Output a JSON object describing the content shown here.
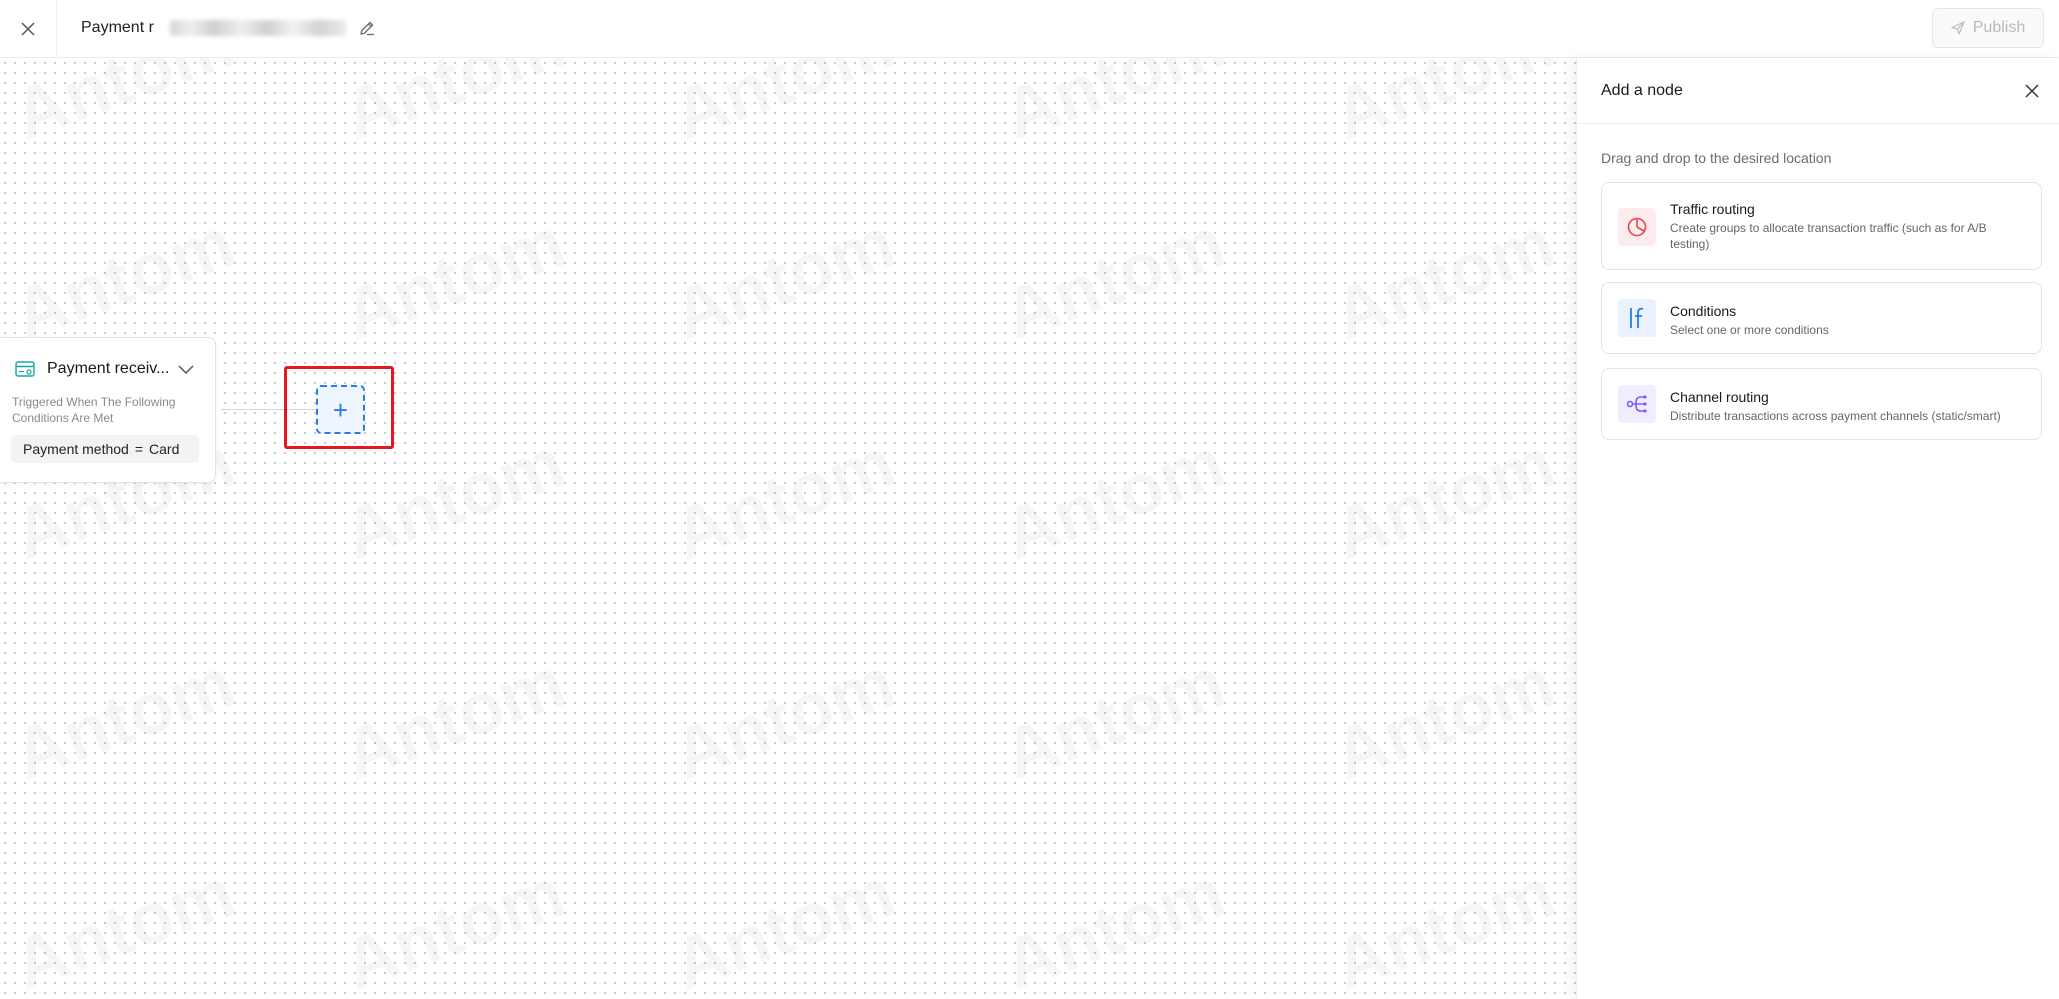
{
  "header": {
    "title_prefix": "Payment r",
    "publish_label": "Publish"
  },
  "canvas": {
    "watermark_text": "Antom",
    "trigger_node": {
      "title": "Payment receiv...",
      "description": "Triggered When The Following Conditions Are Met",
      "condition": {
        "field": "Payment method",
        "operator": "=",
        "value": "Card"
      }
    },
    "add_node_symbol": "+"
  },
  "panel": {
    "title": "Add a node",
    "hint": "Drag and drop to the desired location",
    "nodes": [
      {
        "title": "Traffic routing",
        "description": "Create groups to allocate transaction traffic (such as for A/B testing)",
        "icon": "pie-chart-icon",
        "color": "#e5484d"
      },
      {
        "title": "Conditions",
        "description": "Select one or more conditions",
        "icon": "if-icon",
        "color": "#2b7be6"
      },
      {
        "title": "Channel routing",
        "description": "Distribute transactions across payment channels (static/smart)",
        "icon": "branch-icon",
        "color": "#7b5cf5"
      }
    ]
  },
  "colors": {
    "accent": "#2b7be6",
    "highlight": "#e6161e"
  }
}
